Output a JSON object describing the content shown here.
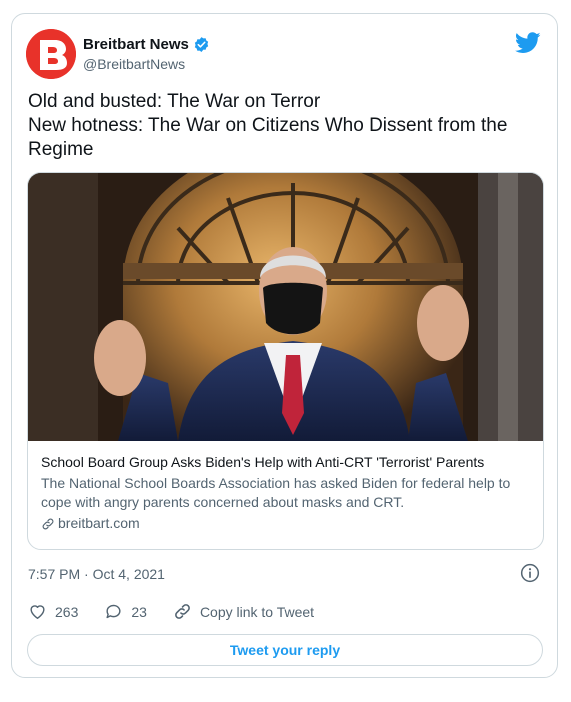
{
  "author": {
    "name": "Breitbart News",
    "handle": "@BreitbartNews",
    "avatar_icon": "breitbart-logo-icon",
    "verified": true
  },
  "tweet": {
    "lines": [
      "Old and busted: The War on Terror",
      "New hotness: The War on Citizens Who Dissent from the",
      "Regime"
    ]
  },
  "link_card": {
    "image_icon": "press-photo",
    "title": "School Board Group Asks Biden's Help with Anti-CRT 'Terrorist' Parents",
    "description": "The National School Boards Association has asked Biden for federal help to cope with angry parents concerned about masks and CRT.",
    "domain": "breitbart.com"
  },
  "timestamp": "7:57 PM · Oct 4, 2021",
  "actions": {
    "likes": "263",
    "replies": "23",
    "copy_link": "Copy link to Tweet"
  },
  "reply_button": "Tweet your reply",
  "colors": {
    "accent": "#1d9bf0",
    "brand_red": "#e8322a",
    "border": "#cfd9de",
    "secondary_text": "#536471"
  }
}
